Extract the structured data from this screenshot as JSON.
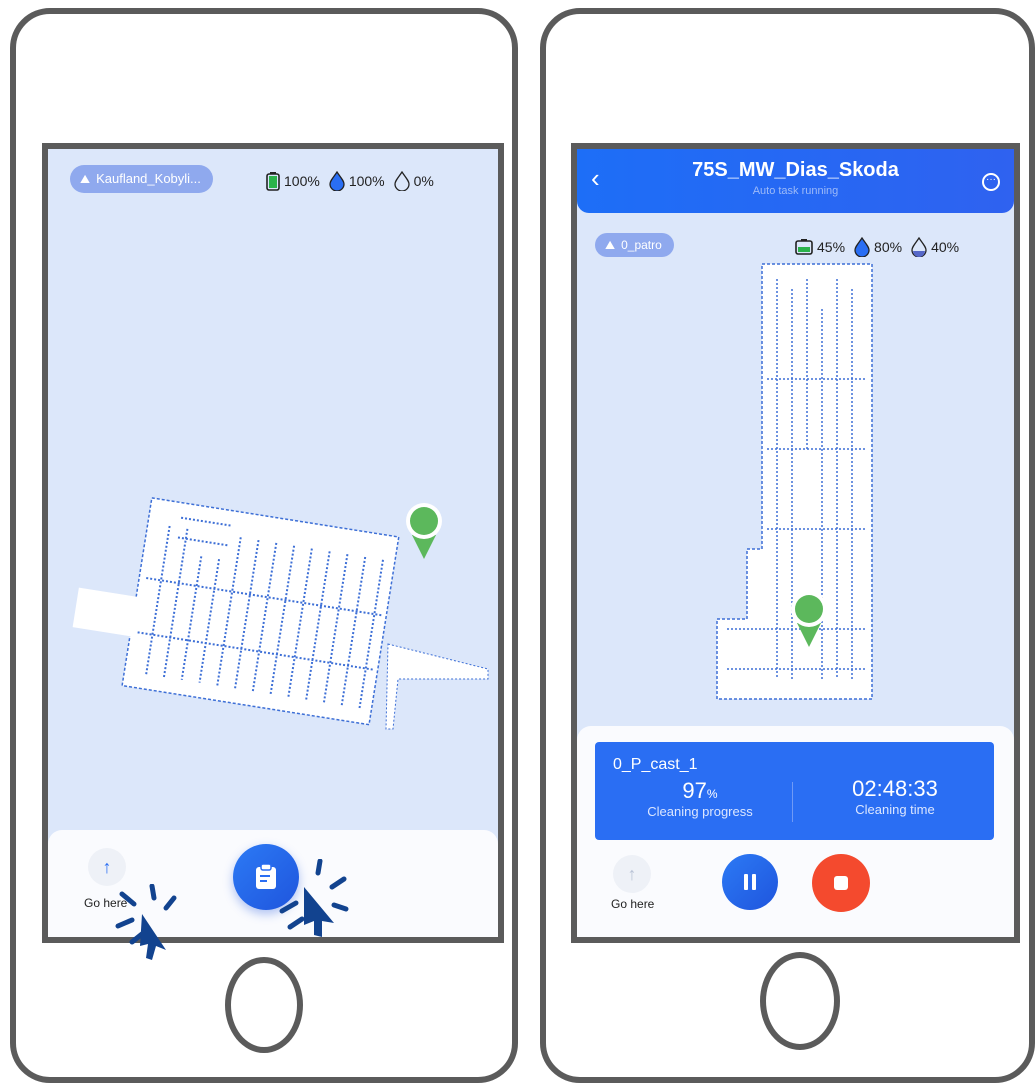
{
  "left_screen": {
    "map_name": "Kaufland_Kobyli...",
    "battery": "100%",
    "clean_water": "100%",
    "dirty_water": "0%",
    "go_here_label": "Go here",
    "task_button_icon": "clipboard-icon"
  },
  "right_screen": {
    "title": "75S_MW_Dias_Skoda",
    "subtitle": "Auto task running",
    "map_name": "0_patro",
    "battery": "45%",
    "clean_water": "80%",
    "dirty_water": "40%",
    "task_name": "0_P_cast_1",
    "progress_value": "97",
    "progress_unit": "%",
    "progress_label": "Cleaning progress",
    "time_value": "02:48:33",
    "time_label": "Cleaning time",
    "go_here_label": "Go here"
  },
  "colors": {
    "accent": "#2a6ef3",
    "map_bg": "#dce7fa",
    "stop": "#f44a2e",
    "robot_pin": "#5cb85c",
    "cursor": "#12438f"
  }
}
